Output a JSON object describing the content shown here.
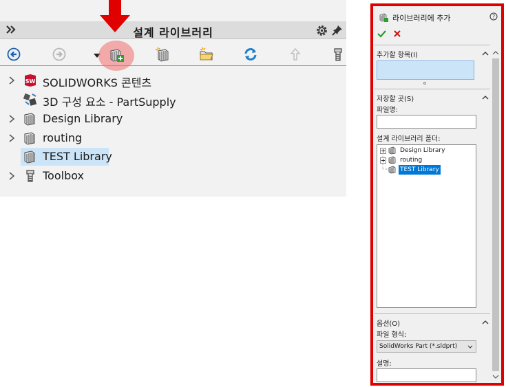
{
  "design_library": {
    "title": "설계 라이브러리",
    "tree": [
      {
        "label": "SOLIDWORKS 콘텐츠",
        "icon": "solidworks-logo-icon",
        "expandable": true
      },
      {
        "label": "3D 구성 요소 - PartSupply",
        "icon": "partsupply-icon",
        "expandable": false
      },
      {
        "label": "Design Library",
        "icon": "library-folder-icon",
        "expandable": true
      },
      {
        "label": "routing",
        "icon": "library-folder-icon",
        "expandable": true
      },
      {
        "label": "TEST Library",
        "icon": "library-folder-icon",
        "expandable": false,
        "selected": true
      },
      {
        "label": "Toolbox",
        "icon": "toolbox-icon",
        "expandable": true
      }
    ]
  },
  "add_to_library": {
    "title": "라이브러리에 추가",
    "items_section": "추가할 항목(I)",
    "save_section": "저장할 곳(S)",
    "filename_label": "파일명:",
    "filename_value": "",
    "folder_label": "설계 라이브러리 폴더:",
    "folders": [
      {
        "label": "Design Library",
        "expandable": true
      },
      {
        "label": "routing",
        "expandable": true
      },
      {
        "label": "TEST Library",
        "expandable": false,
        "selected": true
      }
    ],
    "options_section": "옵션(O)",
    "format_label": "파일 형식:",
    "format_value": "SolidWorks Part (*.sldprt)",
    "description_label": "설명:",
    "description_value": ""
  },
  "colors": {
    "highlight_frame": "#e00000",
    "arrow": "#e00000",
    "selection": "#cce4f7",
    "tree_selection": "#0078d7",
    "ok": "#2a9d2a",
    "cancel": "#d01010"
  }
}
